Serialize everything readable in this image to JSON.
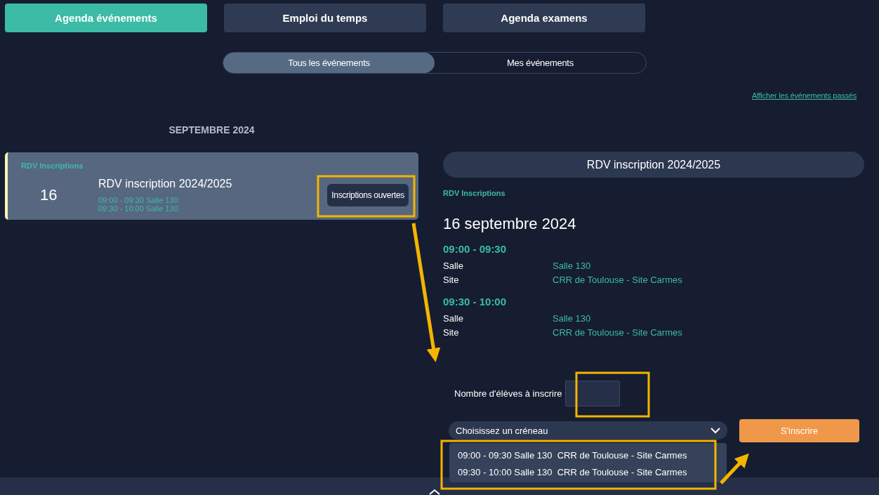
{
  "tabs": [
    {
      "label": "Agenda événements",
      "selected": true
    },
    {
      "label": "Emploi du temps",
      "selected": false
    },
    {
      "label": "Agenda examens",
      "selected": false
    }
  ],
  "filter": [
    {
      "label": "Tous les événements",
      "selected": true
    },
    {
      "label": "Mes événements",
      "selected": false
    }
  ],
  "past_link": "Afficher les événements passés",
  "month": "SEPTEMBRE 2024",
  "events": [
    {
      "category": "RDV Inscriptions",
      "day": "16",
      "title": "RDV inscription 2024/2025",
      "slots": [
        "09:00 - 09:30 Salle 130",
        "09:30 - 10:00 Salle 130"
      ],
      "status": "Inscriptions ouvertes",
      "selected": true
    }
  ],
  "detail": {
    "title": "RDV inscription 2024/2025",
    "category": "RDV Inscriptions",
    "date": "16 septembre 2024",
    "sessions": [
      {
        "time": "09:00 - 09:30",
        "fields": [
          {
            "label": "Salle",
            "value": "Salle 130"
          },
          {
            "label": "Site",
            "value": "CRR de Toulouse - Site Carmes"
          }
        ]
      },
      {
        "time": "09:30 - 10:00",
        "fields": [
          {
            "label": "Salle",
            "value": "Salle 130"
          },
          {
            "label": "Site",
            "value": "CRR de Toulouse - Site Carmes"
          }
        ]
      }
    ],
    "count_label": "Nombre d'élèves à inscrire",
    "slot_select": {
      "placeholder": "Choisissez un créneau",
      "expanded": true,
      "options": [
        "09:00 - 09:30 Salle 130  CRR de Toulouse - Site Carmes",
        "09:30 - 10:00 Salle 130  CRR de Toulouse - Site Carmes"
      ]
    },
    "submit": "S'inscrire"
  }
}
